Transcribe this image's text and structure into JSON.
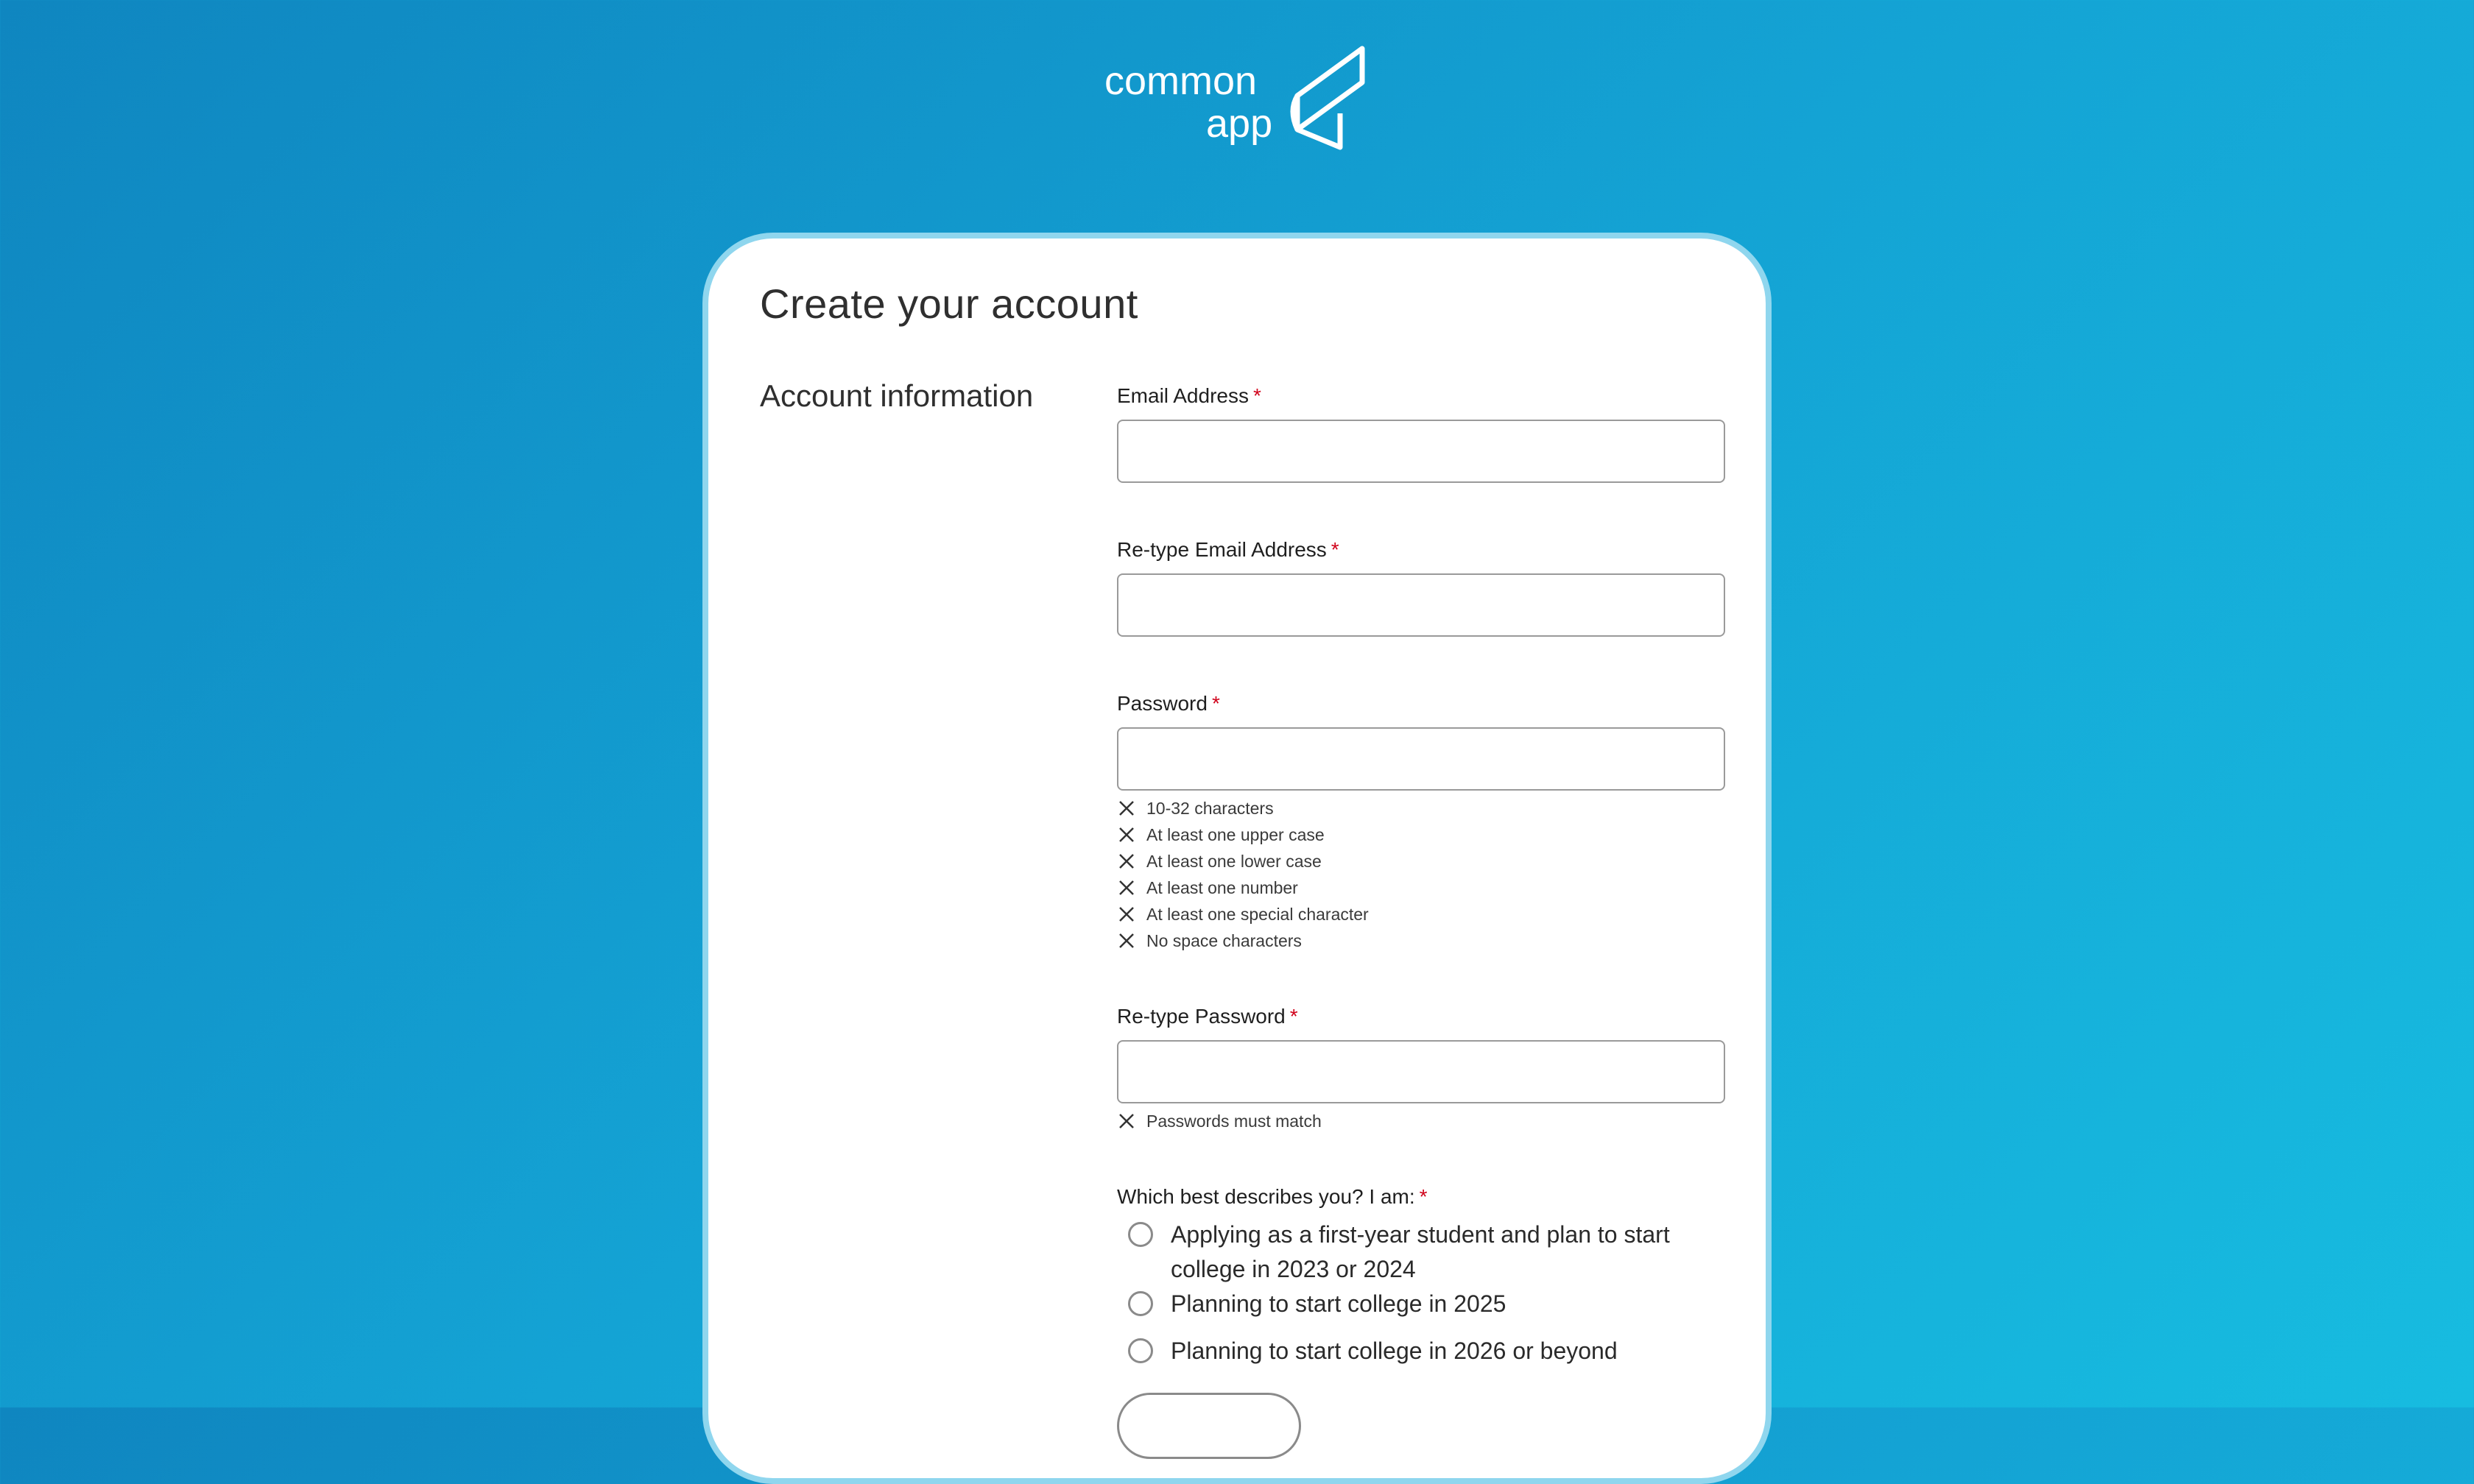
{
  "brand": {
    "logo_line1": "common",
    "logo_line2": "app"
  },
  "card": {
    "title": "Create your account"
  },
  "section": {
    "title": "Account information"
  },
  "fields": {
    "email_label": "Email Address",
    "retype_email_label": "Re-type Email Address",
    "password_label": "Password",
    "retype_password_label": "Re-type Password",
    "required_marker": "*"
  },
  "password_rules": [
    "10-32 characters",
    "At least one upper case",
    "At least one lower case",
    "At least one number",
    "At least one special character",
    "No space characters"
  ],
  "retype_rules": [
    "Passwords must match"
  ],
  "describe": {
    "label": "Which best describes you? I am:",
    "options": [
      "Applying as a first-year student and plan to start college in 2023 or 2024",
      "Planning to start college in 2025",
      "Planning to start college in 2026 or beyond"
    ]
  },
  "colors": {
    "required": "#d0021b",
    "card_border": "#8fd6ee",
    "bg_start": "#0f86c0",
    "bg_end": "#17bce0"
  }
}
